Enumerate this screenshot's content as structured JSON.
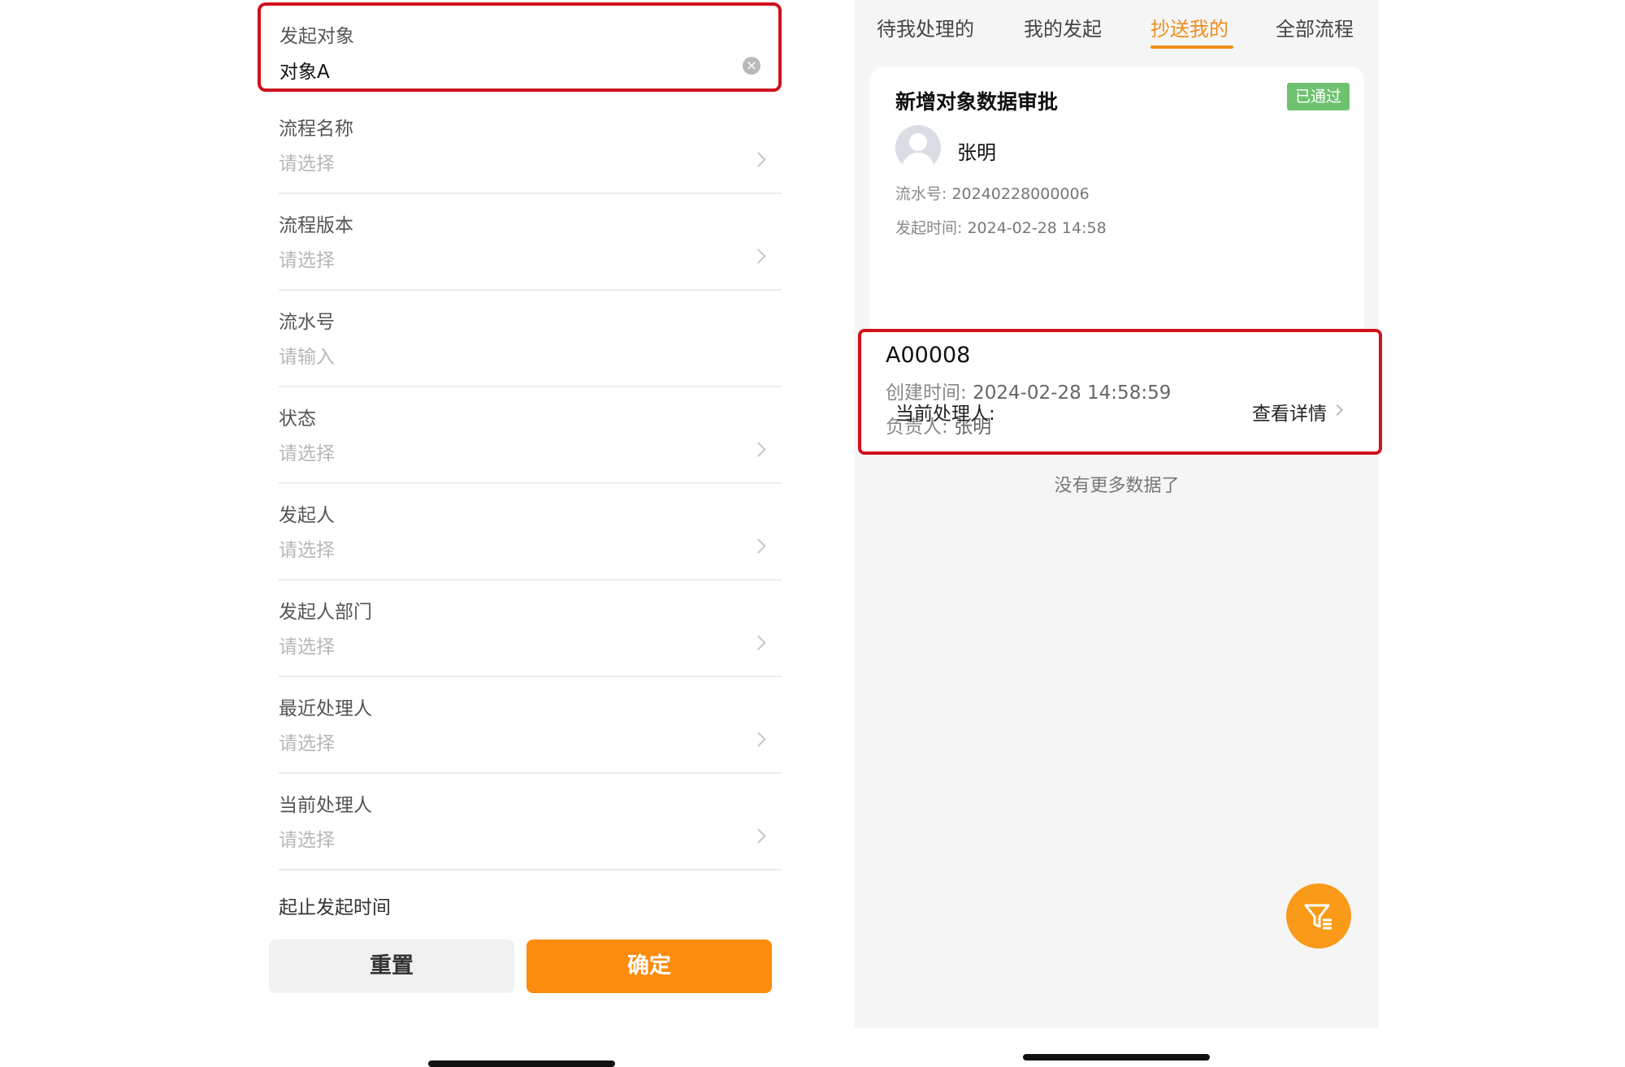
{
  "filter_panel": {
    "target": {
      "label": "发起对象",
      "value": "对象A"
    },
    "fields": [
      {
        "label": "流程名称",
        "placeholder": "请选择",
        "has_arrow": true
      },
      {
        "label": "流程版本",
        "placeholder": "请选择",
        "has_arrow": true
      },
      {
        "label": "流水号",
        "placeholder": "请输入",
        "has_arrow": false
      },
      {
        "label": "状态",
        "placeholder": "请选择",
        "has_arrow": true
      },
      {
        "label": "发起人",
        "placeholder": "请选择",
        "has_arrow": true
      },
      {
        "label": "发起人部门",
        "placeholder": "请选择",
        "has_arrow": true
      },
      {
        "label": "最近处理人",
        "placeholder": "请选择",
        "has_arrow": true
      },
      {
        "label": "当前处理人",
        "placeholder": "请选择",
        "has_arrow": true
      }
    ],
    "time_range_label": "起止发起时间",
    "reset_label": "重置",
    "confirm_label": "确定"
  },
  "list_panel": {
    "tabs": [
      {
        "label": "待我处理的",
        "active": false
      },
      {
        "label": "我的发起",
        "active": false
      },
      {
        "label": "抄送我的",
        "active": true
      },
      {
        "label": "全部流程",
        "active": false
      }
    ],
    "card": {
      "title": "新增对象数据审批",
      "status": "已通过",
      "initiator": "张明",
      "serial_label": "流水号:",
      "serial_value": "20240228000006",
      "start_time_label": "发起时间:",
      "start_time_value": "2024-02-28 14:58",
      "object": {
        "code": "A00008",
        "created_label": "创建时间:",
        "created_value": "2024-02-28 14:58:59",
        "owner_label": "负责人:",
        "owner_value": "张明"
      },
      "current_handler_label": "当前处理人:",
      "detail_link": "查看详情"
    },
    "no_more": "没有更多数据了"
  },
  "colors": {
    "accent": "#fb8c0e",
    "highlight": "#d0101e",
    "success": "#6ec26f"
  },
  "icons": {
    "clear": "close-circle-icon",
    "arrow": "chevron-right-icon",
    "filter": "filter-icon",
    "avatar": "user-avatar-icon"
  }
}
